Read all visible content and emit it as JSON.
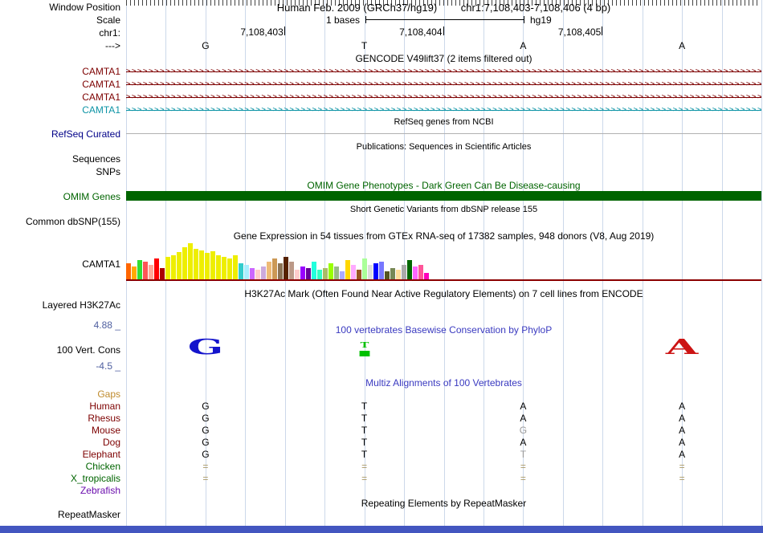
{
  "colors": {
    "maroon": "#7d0000",
    "omim_green": "#006400",
    "navy": "#000088",
    "title_blue": "#3a3ac0",
    "value_blue": "#5060a0",
    "gaps_orange": "#bf8b2e",
    "guideline": "#ccd8ea",
    "baseline_red": "#8b0000",
    "bottom_bar": "#4356c0"
  },
  "header": {
    "window_position_label": "Window Position",
    "assembly_title": "Human Feb. 2009 (GRCh37/hg19)",
    "position_title": "chr1:7,108,403-7,108,406 (4 bp)",
    "scale_label": "Scale",
    "scale_value": "1 bases",
    "scale_assembly": "hg19",
    "chrom_label": "chr1:",
    "coords": [
      "7,108,403",
      "7,108,404",
      "7,108,405"
    ],
    "strand_label": "--->",
    "bases": [
      "G",
      "T",
      "A",
      "A"
    ]
  },
  "gencode": {
    "title": "GENCODE V49lift37 (2 items filtered out)",
    "arrow_char": ">",
    "transcripts": [
      {
        "label": "CAMTA1",
        "color": "#7d0000"
      },
      {
        "label": "CAMTA1",
        "color": "#7d0000"
      },
      {
        "label": "CAMTA1",
        "color": "#7d0000"
      },
      {
        "label": "CAMTA1",
        "color": "#0e94a6"
      }
    ]
  },
  "refseq": {
    "title": "RefSeq genes from NCBI",
    "label": "RefSeq Curated"
  },
  "publications": {
    "title": "Publications: Sequences in Scientific Articles",
    "label": "Sequences"
  },
  "snps": {
    "label": "SNPs"
  },
  "omim": {
    "title": "OMIM Gene Phenotypes - Dark Green Can Be Disease-causing",
    "label": "OMIM Genes"
  },
  "dbsnp": {
    "title": "Short Genetic Variants from dbSNP release 155",
    "label": "Common dbSNP(155)"
  },
  "gtex": {
    "title": "Gene Expression in 54 tissues from GTEx RNA-seq of 17382 samples, 948 donors (V8, Aug 2019)",
    "gene_label": "CAMTA1",
    "chart_data": {
      "type": "bar",
      "values": [
        20,
        16,
        24,
        22,
        18,
        26,
        14,
        28,
        30,
        34,
        40,
        45,
        38,
        36,
        33,
        35,
        30,
        28,
        26,
        30,
        20,
        18,
        14,
        12,
        16,
        22,
        26,
        20,
        28,
        22,
        12,
        16,
        14,
        22,
        12,
        14,
        20,
        16,
        10,
        24,
        18,
        12,
        26,
        18,
        20,
        22,
        10,
        14,
        12,
        18,
        24,
        16,
        18,
        8
      ],
      "colors": [
        "#FF6600",
        "#FFAA00",
        "#33DD33",
        "#FF5555",
        "#FFAA99",
        "#FF0000",
        "#AA0000",
        "#EEEE00",
        "#EEEE00",
        "#EEEE00",
        "#EEEE00",
        "#EEEE00",
        "#EEEE00",
        "#EEEE00",
        "#EEEE00",
        "#EEEE00",
        "#EEEE00",
        "#EEEE00",
        "#EEEE00",
        "#EEEE00",
        "#33CCCC",
        "#AAEEFF",
        "#CC66FF",
        "#FFCCCC",
        "#CCAADD",
        "#EEBB77",
        "#CC9955",
        "#8B7355",
        "#552200",
        "#BB9988",
        "#FFCCCC",
        "#9900FF",
        "#660099",
        "#22FFDD",
        "#33FFC2",
        "#AABB66",
        "#99FF00",
        "#99BB88",
        "#AAAAFF",
        "#FFD700",
        "#FFAAFF",
        "#995522",
        "#AAFF99",
        "#DDDDDD",
        "#0000FF",
        "#7777FF",
        "#555522",
        "#778855",
        "#FFDD99",
        "#AAAAAA",
        "#006600",
        "#FF66FF",
        "#FF5599",
        "#FF00BB"
      ]
    }
  },
  "h3k27ac": {
    "title": "H3K27Ac Mark (Often Found Near Active Regulatory Elements) on 7 cell lines from ENCODE",
    "label": "Layered H3K27Ac"
  },
  "conservation": {
    "title": "100 vertebrates Basewise Conservation by PhyloP",
    "label": "100 Vert. Cons",
    "max_value": "4.88 _",
    "min_value": "-4.5 _",
    "glyphs": [
      {
        "letter": "G",
        "color": "#1414cc",
        "size": "large",
        "base": 0
      },
      {
        "letter": "T",
        "color": "#00c000",
        "size": "small",
        "base": 1
      },
      {
        "letter": "A",
        "color": "#cc1414",
        "size": "large",
        "base": 3
      }
    ]
  },
  "multiz": {
    "title": "Multiz Alignments of 100 Vertebrates",
    "gaps_label": "Gaps",
    "species": [
      {
        "name": "Human",
        "color": "#7d0000",
        "cells": [
          {
            "t": "G",
            "c": "#000000"
          },
          {
            "t": "T",
            "c": "#000000"
          },
          {
            "t": "A",
            "c": "#000000"
          },
          {
            "t": "A",
            "c": "#000000"
          }
        ]
      },
      {
        "name": "Rhesus",
        "color": "#7d0000",
        "cells": [
          {
            "t": "G",
            "c": "#000000"
          },
          {
            "t": "T",
            "c": "#000000"
          },
          {
            "t": "A",
            "c": "#000000"
          },
          {
            "t": "A",
            "c": "#000000"
          }
        ]
      },
      {
        "name": "Mouse",
        "color": "#7d0000",
        "cells": [
          {
            "t": "G",
            "c": "#000000"
          },
          {
            "t": "T",
            "c": "#000000"
          },
          {
            "t": "G",
            "c": "#999999"
          },
          {
            "t": "A",
            "c": "#000000"
          }
        ]
      },
      {
        "name": "Dog",
        "color": "#7d0000",
        "cells": [
          {
            "t": "G",
            "c": "#000000"
          },
          {
            "t": "T",
            "c": "#000000"
          },
          {
            "t": "A",
            "c": "#000000"
          },
          {
            "t": "A",
            "c": "#000000"
          }
        ]
      },
      {
        "name": "Elephant",
        "color": "#7d0000",
        "cells": [
          {
            "t": "G",
            "c": "#000000"
          },
          {
            "t": "T",
            "c": "#000000"
          },
          {
            "t": "T",
            "c": "#999999"
          },
          {
            "t": "A",
            "c": "#000000"
          }
        ]
      },
      {
        "name": "Chicken",
        "color": "#006400",
        "cells": [
          {
            "t": "=",
            "c": "#aa9966"
          },
          {
            "t": "=",
            "c": "#aa9966"
          },
          {
            "t": "=",
            "c": "#aa9966"
          },
          {
            "t": "=",
            "c": "#aa9966"
          }
        ]
      },
      {
        "name": "X_tropicalis",
        "color": "#006400",
        "cells": [
          {
            "t": "=",
            "c": "#aa9966"
          },
          {
            "t": "=",
            "c": "#aa9966"
          },
          {
            "t": "=",
            "c": "#aa9966"
          },
          {
            "t": "=",
            "c": "#aa9966"
          }
        ]
      },
      {
        "name": "Zebrafish",
        "color": "#6a0dad",
        "cells": [
          {
            "t": "",
            "c": "#000000"
          },
          {
            "t": "",
            "c": "#000000"
          },
          {
            "t": "",
            "c": "#000000"
          },
          {
            "t": "",
            "c": "#000000"
          }
        ]
      }
    ]
  },
  "repeatmasker": {
    "title": "Repeating Elements by RepeatMasker",
    "label": "RepeatMasker"
  }
}
